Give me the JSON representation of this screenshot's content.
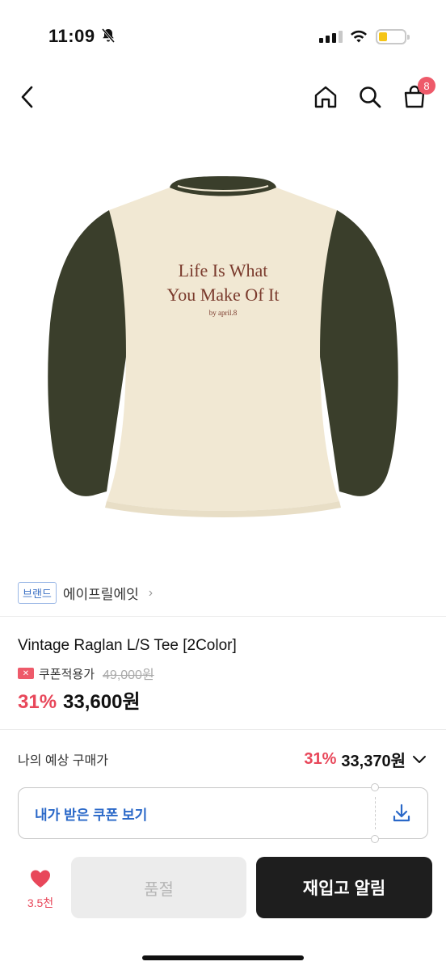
{
  "status": {
    "time": "11:09"
  },
  "nav": {
    "cart_count": "8"
  },
  "product_image": {
    "print_line1": "Life Is What",
    "print_line2": "You Make Of It",
    "print_line3": "by april.8"
  },
  "brand": {
    "tag": "브랜드",
    "name": "에이프릴에잇"
  },
  "product": {
    "title": "Vintage Raglan L/S Tee [2Color]",
    "coupon_label": "쿠폰적용가",
    "original_price": "49,000원",
    "discount": "31%",
    "price": "33,600원"
  },
  "expected": {
    "label": "나의 예상 구매가",
    "discount": "31%",
    "price": "33,370원"
  },
  "coupon_box": {
    "label": "내가 받은 쿠폰 보기"
  },
  "bottom": {
    "like_count": "3.5천",
    "soldout_label": "품절",
    "restock_label": "재입고 알림"
  },
  "colors": {
    "accent_red": "#e8475a",
    "link_blue": "#2a68c8",
    "shirt_body": "#f1e8d3",
    "shirt_sleeve": "#3a3e2b",
    "print_brown": "#7a3a2c"
  }
}
